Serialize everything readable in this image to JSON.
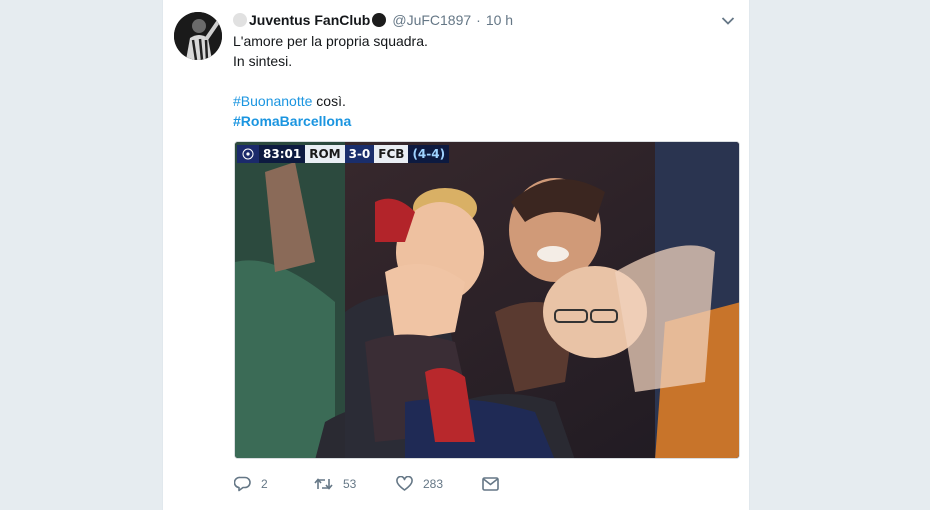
{
  "tweet": {
    "display_name": "Juventus FanClub",
    "handle": "@JuFC1897",
    "separator": "·",
    "time": "10 h",
    "lines": [
      "L'amore per la propria squadra.",
      "In sintesi."
    ],
    "hashtag1": "#Buonanotte",
    "after_hashtag1": " così.",
    "hashtag2": "#RomaBarcellona"
  },
  "media": {
    "scorebug": {
      "clock": "83:01",
      "home": "ROM",
      "score": "3-0",
      "away": "FCB",
      "aggregate": "(4-4)"
    }
  },
  "actions": {
    "replies": "2",
    "retweets": "53",
    "likes": "283"
  },
  "colors": {
    "link": "#1b95e0",
    "muted": "#657786",
    "background": "#e6ecf0"
  },
  "icons": [
    "chevron-down-icon",
    "reply-icon",
    "retweet-icon",
    "heart-icon",
    "message-icon"
  ]
}
